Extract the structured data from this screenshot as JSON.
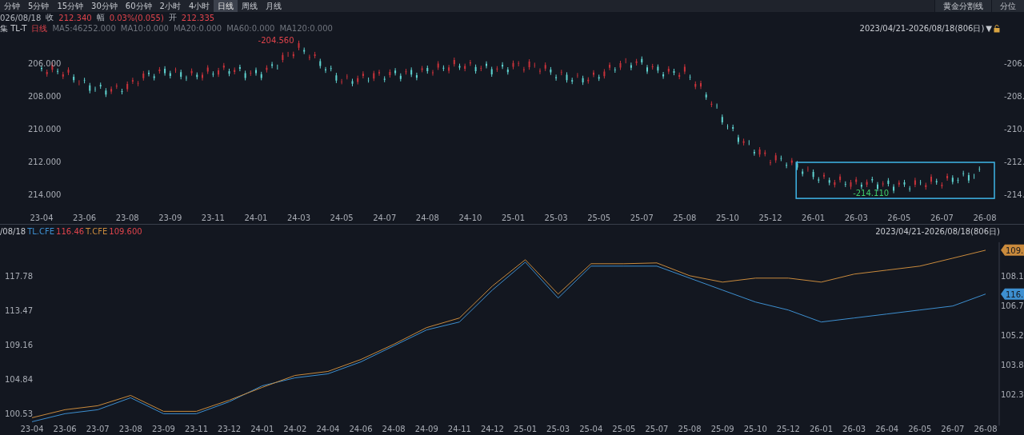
{
  "toolbar": {
    "tabs": [
      {
        "label": "分钟",
        "selected": false
      },
      {
        "label": "5分钟",
        "selected": false
      },
      {
        "label": "15分钟",
        "selected": false
      },
      {
        "label": "30分钟",
        "selected": false
      },
      {
        "label": "60分钟",
        "selected": false
      },
      {
        "label": "2小时",
        "selected": false
      },
      {
        "label": "4小时",
        "selected": false
      },
      {
        "label": "日线",
        "selected": true
      },
      {
        "label": "周线",
        "selected": false
      },
      {
        "label": "月线",
        "selected": false
      }
    ],
    "tools": [
      "黄金分割线",
      "分位"
    ]
  },
  "quote": {
    "date": "026/08/18",
    "close_label": "收",
    "close": "212.340",
    "change_label": "幅",
    "change": "0.03%(0.055)",
    "open_label": "开",
    "open": "212.335"
  },
  "main_chart": {
    "title": "集 TL-T",
    "period": "日线",
    "indicators": [
      "MA5:46252.000",
      "MA10:0.000",
      "MA20:0.000",
      "MA60:0.000",
      "MA120:0.000"
    ],
    "range": "2023/04/21-2026/08/18(806日)",
    "range_arrow": "▼",
    "left_axis_labels": [
      "206.000",
      "208.000",
      "210.000",
      "212.000",
      "214.000"
    ],
    "right_axis_labels": [
      "-206.",
      "-208.",
      "-210.",
      "-212.",
      "-214."
    ],
    "x_axis_labels": [
      "23-04",
      "23-06",
      "23-08",
      "23-09",
      "23-11",
      "24-01",
      "24-03",
      "24-05",
      "24-07",
      "24-08",
      "24-10",
      "25-01",
      "25-03",
      "25-05",
      "25-07",
      "25-08",
      "25-10",
      "25-12",
      "26-01",
      "26-03",
      "26-05",
      "26-07",
      "26-08"
    ],
    "price_marks": [
      {
        "text": "-204.560",
        "kind": "high"
      },
      {
        "text": "-214.110",
        "kind": "low"
      }
    ]
  },
  "compare_chart": {
    "date": "/08/18",
    "legend": [
      {
        "value": "116.46"
      },
      {
        "value": "109.600"
      }
    ],
    "range": "2023/04/21-2026/08/18(806日)",
    "right_axis_labels": [
      "108.1",
      "106.7",
      "105.2",
      "103.8",
      "102.3"
    ],
    "value_tags": [
      {
        "text": "109.",
        "color": "#c98a3c"
      },
      {
        "text": "116.",
        "color": "#3d8fd0"
      }
    ],
    "chart_data": {
      "type": "line",
      "categories": [
        "23-04",
        "23-06",
        "23-07",
        "23-08",
        "23-09",
        "23-11",
        "23-12",
        "24-01",
        "24-02",
        "24-04",
        "24-06",
        "24-08",
        "24-09",
        "24-11",
        "24-12",
        "25-01",
        "25-03",
        "25-04",
        "25-05",
        "25-07",
        "25-08",
        "25-09",
        "25-10",
        "25-12",
        "26-01",
        "26-03",
        "26-04",
        "26-05",
        "26-07",
        "26-08"
      ],
      "series": [
        {
          "name": "TL.CFE",
          "color": "#3d8fd0",
          "values": [
            99.5,
            100.5,
            101,
            102.5,
            100.5,
            100.5,
            102,
            104,
            105,
            105.5,
            107,
            109,
            111,
            112,
            116,
            119.5,
            115,
            119,
            119,
            119,
            117.5,
            116,
            114.5,
            113.5,
            112,
            112.5,
            113,
            113.5,
            114,
            115.5
          ]
        },
        {
          "name": "T.CFE",
          "color": "#c98a3c",
          "values": [
            100,
            101,
            101.5,
            102.8,
            100.8,
            100.8,
            102.2,
            103.8,
            105.3,
            105.8,
            107.3,
            109.2,
            111.3,
            112.5,
            116.5,
            119.8,
            115.5,
            119.3,
            119.3,
            119.4,
            117.8,
            117,
            117.5,
            117.5,
            117,
            118,
            118.5,
            119,
            120,
            121
          ]
        }
      ],
      "ylim": [
        99,
        122
      ],
      "yticks": [
        {
          "value": 117.78,
          "label": "117.78"
        },
        {
          "value": 113.47,
          "label": "113.47"
        },
        {
          "value": 109.16,
          "label": "109.16"
        },
        {
          "value": 104.84,
          "label": "104.84"
        },
        {
          "value": 100.53,
          "label": "100.53"
        }
      ]
    }
  }
}
